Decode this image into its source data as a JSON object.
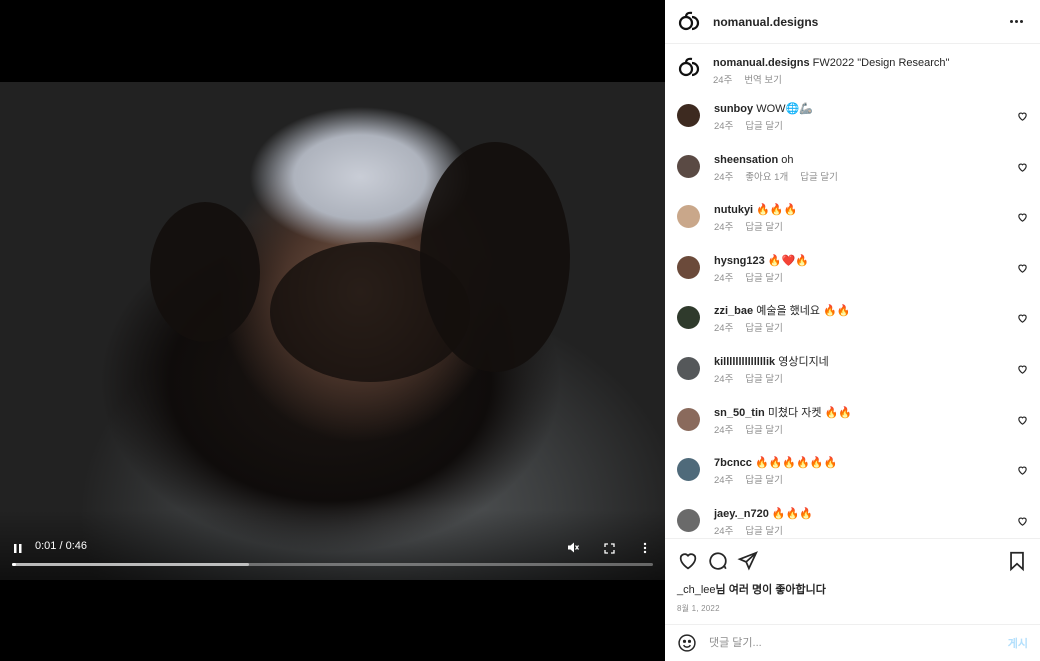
{
  "video": {
    "time": "0:01 / 0:46",
    "progress": 0.006,
    "buffered": 0.37,
    "icons": [
      "pause-icon",
      "mute-icon",
      "fullscreen-icon",
      "more-vertical-icon"
    ]
  },
  "panel": {
    "header": {
      "username": "nomanual.designs"
    },
    "caption": {
      "username": "nomanual.designs",
      "text": "FW2022 \"Design Research\"",
      "age": "24주",
      "translate": "번역 보기"
    },
    "comments": [
      {
        "user": "sunboy",
        "text": "WOW🌐🦾",
        "age": "24주",
        "likes": "",
        "reply": "답글 달기",
        "avatar_color": "#3d2a20"
      },
      {
        "user": "sheensation",
        "text": "oh",
        "age": "24주",
        "likes": "좋아요 1개",
        "reply": "답글 달기",
        "avatar_color": "#5a4a44"
      },
      {
        "user": "nutukyi",
        "text": "🔥🔥🔥",
        "age": "24주",
        "likes": "",
        "reply": "답글 달기",
        "avatar_color": "#c9a78a"
      },
      {
        "user": "hysng123",
        "text": "🔥❤️🔥",
        "age": "24주",
        "likes": "",
        "reply": "답글 달기",
        "avatar_color": "#6b4a3a"
      },
      {
        "user": "zzi_bae",
        "text": "예술을 했네요 🔥🔥",
        "age": "24주",
        "likes": "",
        "reply": "답글 달기",
        "avatar_color": "#2f3a2c"
      },
      {
        "user": "killllllllllllllik",
        "text": "영상디지네",
        "age": "24주",
        "likes": "",
        "reply": "답글 달기",
        "avatar_color": "#55585a"
      },
      {
        "user": "sn_50_tin",
        "text": "미쳤다 자켓 🔥🔥",
        "age": "24주",
        "likes": "",
        "reply": "답글 달기",
        "avatar_color": "#8a6a5c"
      },
      {
        "user": "7bcncc",
        "text": "🔥🔥🔥🔥🔥🔥",
        "age": "24주",
        "likes": "",
        "reply": "답글 달기",
        "avatar_color": "#4f6a7a"
      },
      {
        "user": "jaey._n720",
        "text": "🔥🔥🔥",
        "age": "24주",
        "likes": "",
        "reply": "답글 달기",
        "avatar_color": "#6a6a6a"
      }
    ],
    "likes_text_user": "_ch_lee",
    "likes_text_rest": "님 여러 명이 좋아합니다",
    "date": "8월 1, 2022",
    "comment_placeholder": "댓글 달기...",
    "post_label": "게시"
  }
}
